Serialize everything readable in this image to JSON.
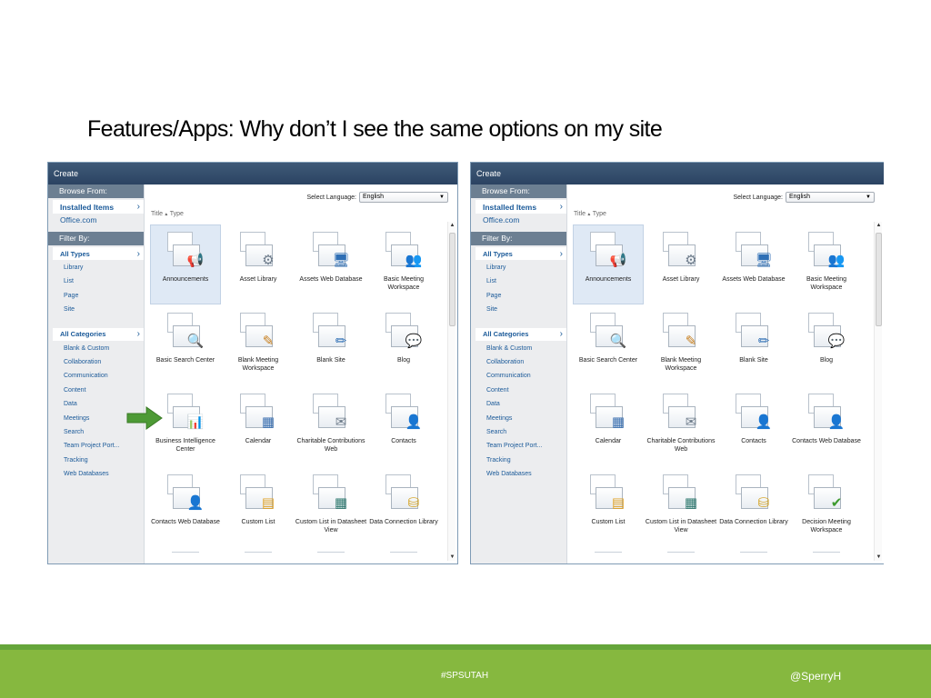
{
  "slide": {
    "title": "Features/Apps:  Why don’t I see the same options on my site",
    "footer_tag": "#SPSUTAH",
    "footer_handle": "@SperryH"
  },
  "dialogs": [
    {
      "header": "Create",
      "browse_from_label": "Browse From:",
      "installed_items": "Installed Items",
      "office_com": "Office.com",
      "filter_by_label": "Filter By:",
      "all_types": "All Types",
      "types": [
        "Library",
        "List",
        "Page",
        "Site"
      ],
      "all_categories": "All Categories",
      "categories": [
        "Blank & Custom",
        "Collaboration",
        "Communication",
        "Content",
        "Data",
        "Meetings",
        "Search",
        "Team Project Port...",
        "Tracking",
        "Web Databases"
      ],
      "select_language_label": "Select Language:",
      "language_value": "English",
      "sort_title": "Title",
      "sort_type": "Type",
      "tiles": [
        {
          "name": "Announcements",
          "icon": "megaphone-icon",
          "selected": true
        },
        {
          "name": "Asset Library",
          "icon": "film-reel-icon"
        },
        {
          "name": "Assets Web Database",
          "icon": "monitor-icon"
        },
        {
          "name": "Basic Meeting Workspace",
          "icon": "meeting-people-icon"
        },
        {
          "name": "Basic Search Center",
          "icon": "magnifier-icon"
        },
        {
          "name": "Blank Meeting Workspace",
          "icon": "meeting-pencil-icon"
        },
        {
          "name": "Blank Site",
          "icon": "pencil-icon"
        },
        {
          "name": "Blog",
          "icon": "speech-bubble-icon"
        },
        {
          "name": "Business Intelligence Center",
          "icon": "bar-chart-icon"
        },
        {
          "name": "Calendar",
          "icon": "calendar-icon"
        },
        {
          "name": "Charitable Contributions Web",
          "icon": "envelope-icon"
        },
        {
          "name": "Contacts",
          "icon": "contact-card-icon"
        },
        {
          "name": "Contacts Web Database",
          "icon": "contact-card-icon"
        },
        {
          "name": "Custom List",
          "icon": "list-table-icon"
        },
        {
          "name": "Custom List in Datasheet View",
          "icon": "datasheet-icon"
        },
        {
          "name": "Data Connection Library",
          "icon": "database-icon"
        }
      ]
    },
    {
      "header": "Create",
      "browse_from_label": "Browse From:",
      "installed_items": "Installed Items",
      "office_com": "Office.com",
      "filter_by_label": "Filter By:",
      "all_types": "All Types",
      "types": [
        "Library",
        "List",
        "Page",
        "Site"
      ],
      "all_categories": "All Categories",
      "categories": [
        "Blank & Custom",
        "Collaboration",
        "Communication",
        "Content",
        "Data",
        "Meetings",
        "Search",
        "Team Project Port...",
        "Tracking",
        "Web Databases"
      ],
      "select_language_label": "Select Language:",
      "language_value": "English",
      "sort_title": "Title",
      "sort_type": "Type",
      "tiles": [
        {
          "name": "Announcements",
          "icon": "megaphone-icon",
          "selected": true
        },
        {
          "name": "Asset Library",
          "icon": "film-reel-icon"
        },
        {
          "name": "Assets Web Database",
          "icon": "monitor-icon"
        },
        {
          "name": "Basic Meeting Workspace",
          "icon": "meeting-people-icon"
        },
        {
          "name": "Basic Search Center",
          "icon": "magnifier-icon"
        },
        {
          "name": "Blank Meeting Workspace",
          "icon": "meeting-pencil-icon"
        },
        {
          "name": "Blank Site",
          "icon": "pencil-icon"
        },
        {
          "name": "Blog",
          "icon": "speech-bubble-icon"
        },
        {
          "name": "Calendar",
          "icon": "calendar-icon"
        },
        {
          "name": "Charitable Contributions Web",
          "icon": "envelope-icon"
        },
        {
          "name": "Contacts",
          "icon": "contact-card-icon"
        },
        {
          "name": "Contacts Web Database",
          "icon": "contact-card-icon"
        },
        {
          "name": "Custom List",
          "icon": "list-table-icon"
        },
        {
          "name": "Custom List in Datasheet View",
          "icon": "datasheet-icon"
        },
        {
          "name": "Data Connection Library",
          "icon": "database-icon"
        },
        {
          "name": "Decision Meeting Workspace",
          "icon": "decision-check-icon"
        }
      ]
    }
  ],
  "colors": {
    "dialog_header": "#2e4766",
    "link_blue": "#1b5a99",
    "footer_green": "#86b83f",
    "arrow_green": "#4d9a35"
  }
}
